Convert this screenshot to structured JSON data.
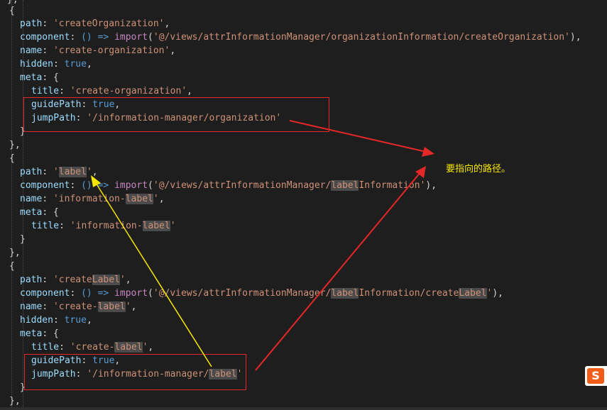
{
  "editor": {
    "lines": {
      "l0": "},",
      "l1": "{",
      "l2": {
        "key": "path",
        "val": "'createOrganization'"
      },
      "l3": {
        "key": "component",
        "arrow": "() => ",
        "kw": "import",
        "val": "'@/views/attrInformationManager/organizationInformation/createOrganization'"
      },
      "l4": {
        "key": "name",
        "val": "'create-organization'"
      },
      "l5": {
        "key": "hidden",
        "val": "true"
      },
      "l6": {
        "key": "meta",
        "val": "{"
      },
      "l7": {
        "key": "title",
        "val": "'create-organization'"
      },
      "l8": {
        "key": "guidePath",
        "val": "true"
      },
      "l9": {
        "key": "jumpPath",
        "val": "'/information-manager/organization'"
      },
      "l10": "}",
      "l11": "},",
      "l12": "{",
      "l13": {
        "key": "path",
        "q1": "'",
        "hl": "label",
        "q2": "'"
      },
      "l14": {
        "key": "component",
        "arrow": "() => ",
        "kw": "import",
        "a": "'@/views/attrInformationManager/",
        "hl": "label",
        "b": "Information'"
      },
      "l15": {
        "key": "name",
        "a": "'information-",
        "hl": "label",
        "b": "'"
      },
      "l16": {
        "key": "meta",
        "val": "{"
      },
      "l17": {
        "key": "title",
        "a": "'information-",
        "hl": "label",
        "b": "'"
      },
      "l18": "}",
      "l19": "},",
      "l20": "{",
      "l21": {
        "key": "path",
        "a": "'create",
        "hl": "Label",
        "b": "'"
      },
      "l22": {
        "key": "component",
        "arrow": "() => ",
        "kw": "import",
        "a": "'@/views/attrInformationManager/",
        "hl1": "label",
        "m": "Information/create",
        "hl2": "Label",
        "b": "'"
      },
      "l23": {
        "key": "name",
        "a": "'create-",
        "hl": "label",
        "b": "'"
      },
      "l24": {
        "key": "hidden",
        "val": "true"
      },
      "l25": {
        "key": "meta",
        "val": "{"
      },
      "l26": {
        "key": "title",
        "a": "'create-",
        "hl": "label",
        "b": "'"
      },
      "l27": {
        "key": "guidePath",
        "val": "true"
      },
      "l28": {
        "key": "jumpPath",
        "a": "'/information-manager/",
        "hl": "label",
        "b": "'"
      },
      "l29": "}",
      "l30": "},"
    }
  },
  "annotation": {
    "text": "要指向的路径。"
  },
  "ime_badge": {
    "label": "S"
  },
  "colors": {
    "background": "#1e1e1e",
    "property": "#9cdcfe",
    "string": "#ce9178",
    "boolean": "#569cd6",
    "keyword": "#c586c0",
    "red_annotation": "#e52727",
    "yellow_annotation": "#f7e600"
  }
}
